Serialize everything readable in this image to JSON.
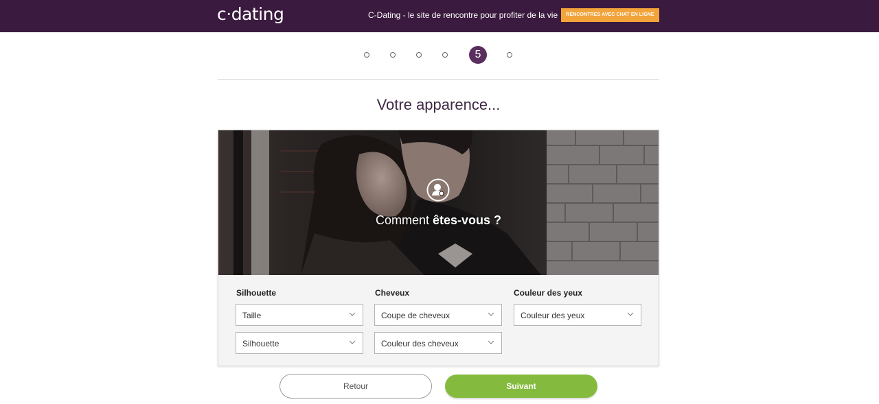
{
  "header": {
    "logo": "c·dating",
    "tagline": "C-Dating - le site de rencontre pour profiter de la vie",
    "cta_label": "RENCONTRES AVEC CHAT EN LIGNE"
  },
  "stepper": {
    "current_step": "5",
    "total_steps": 6
  },
  "page_title": "Votre apparence...",
  "hero": {
    "icon": "user-profile-icon",
    "title_prefix": "Comment ",
    "title_emphasis": "êtes-vous ?"
  },
  "form": {
    "columns": [
      {
        "label": "Silhouette",
        "selects": [
          "Taille",
          "Silhouette"
        ]
      },
      {
        "label": "Cheveux",
        "selects": [
          "Coupe de cheveux",
          "Couleur des cheveux"
        ]
      },
      {
        "label": "Couleur des yeux",
        "selects": [
          "Couleur des yeux"
        ]
      }
    ]
  },
  "buttons": {
    "back": "Retour",
    "next": "Suivant"
  },
  "colors": {
    "header_bg": "#3b1a3f",
    "cta_bg": "#f2a33a",
    "step_active": "#5a2f5e",
    "next_button": "#84bb3e"
  }
}
